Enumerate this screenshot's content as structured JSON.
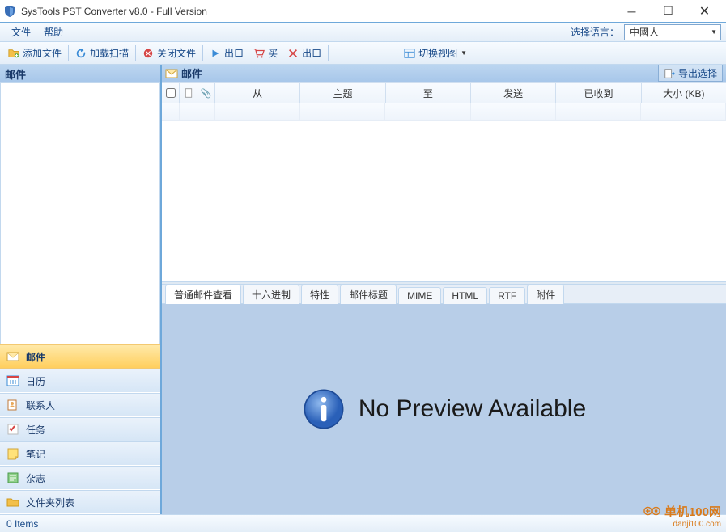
{
  "window": {
    "title": "SysTools PST Converter v8.0 - Full Version"
  },
  "menu": {
    "file": "文件",
    "help": "帮助",
    "lang_label": "选择语言：",
    "lang_value": "中國人"
  },
  "toolbar": {
    "add_file": "添加文件",
    "load_scan": "加载扫描",
    "close_file": "关闭文件",
    "export": "出口",
    "buy": "买",
    "export2": "出口",
    "switch_view": "切换视图"
  },
  "left": {
    "header": "邮件",
    "cats": [
      {
        "key": "mail",
        "label": "邮件",
        "icon": "mail"
      },
      {
        "key": "calendar",
        "label": "日历",
        "icon": "calendar"
      },
      {
        "key": "contacts",
        "label": "联系人",
        "icon": "contacts"
      },
      {
        "key": "tasks",
        "label": "任务",
        "icon": "tasks"
      },
      {
        "key": "notes",
        "label": "笔记",
        "icon": "notes"
      },
      {
        "key": "journal",
        "label": "杂志",
        "icon": "journal"
      },
      {
        "key": "folders",
        "label": "文件夹列表",
        "icon": "folders"
      }
    ]
  },
  "right": {
    "header_label": "邮件",
    "export_selected": "导出选择"
  },
  "columns": {
    "attachment": "📎",
    "from": "从",
    "subject": "主题",
    "to": "至",
    "sent": "发送",
    "received": "已收到",
    "size": "大小 (KB)"
  },
  "tabs": [
    "普通邮件查看",
    "十六进制",
    "特性",
    "邮件标题",
    "MIME",
    "HTML",
    "RTF",
    "附件"
  ],
  "preview": {
    "no_preview": "No Preview Available"
  },
  "status": {
    "items": "0 Items"
  },
  "watermark": {
    "line1": "单机100网",
    "line2": "danji100.com"
  }
}
